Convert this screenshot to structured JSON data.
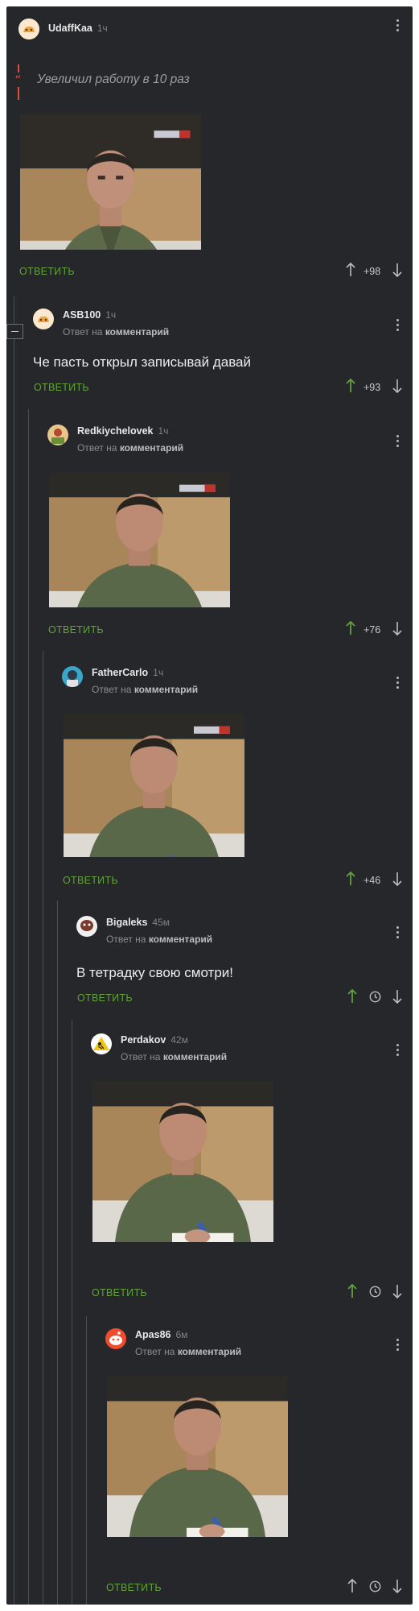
{
  "post": {
    "author": "UdaffKaa",
    "time": "1ч",
    "quote": "Увеличил работу в 10 раз",
    "reply_label": "ОТВЕТИТЬ",
    "rating": "+98"
  },
  "comments": [
    {
      "author": "ASB100",
      "time": "1ч",
      "reply_prefix": "Ответ на",
      "reply_target": "комментарий",
      "text": "Че пасть открыл записывай давай",
      "reply_label": "ОТВЕТИТЬ",
      "rating": "+93"
    },
    {
      "author": "Redkiychelovek",
      "time": "1ч",
      "reply_prefix": "Ответ на",
      "reply_target": "комментарий",
      "reply_label": "ОТВЕТИТЬ",
      "rating": "+76"
    },
    {
      "author": "FatherCarlo",
      "time": "1ч",
      "reply_prefix": "Ответ на",
      "reply_target": "комментарий",
      "reply_label": "ОТВЕТИТЬ",
      "rating": "+46"
    },
    {
      "author": "Bigaleks",
      "time": "45м",
      "reply_prefix": "Ответ на",
      "reply_target": "комментарий",
      "text": "В тетрадку свою смотри!",
      "reply_label": "ОТВЕТИТЬ"
    },
    {
      "author": "Perdakov",
      "time": "42м",
      "reply_prefix": "Ответ на",
      "reply_target": "комментарий",
      "reply_label": "ОТВЕТИТЬ"
    },
    {
      "author": "Apas86",
      "time": "6м",
      "reply_prefix": "Ответ на",
      "reply_target": "комментарий",
      "reply_label": "ОТВЕТИТЬ"
    }
  ],
  "tv_logo": "РОССИЯ 24",
  "colors": {
    "background": "#25272b",
    "accent_green": "#63a23b",
    "thread_line": "#4b4e53",
    "quote_red": "#e24c3a"
  },
  "icons": [
    "menu-dots-icon",
    "upvote-arrow-icon",
    "downvote-arrow-icon",
    "clock-icon",
    "collapse-icon",
    "quote-icon"
  ]
}
